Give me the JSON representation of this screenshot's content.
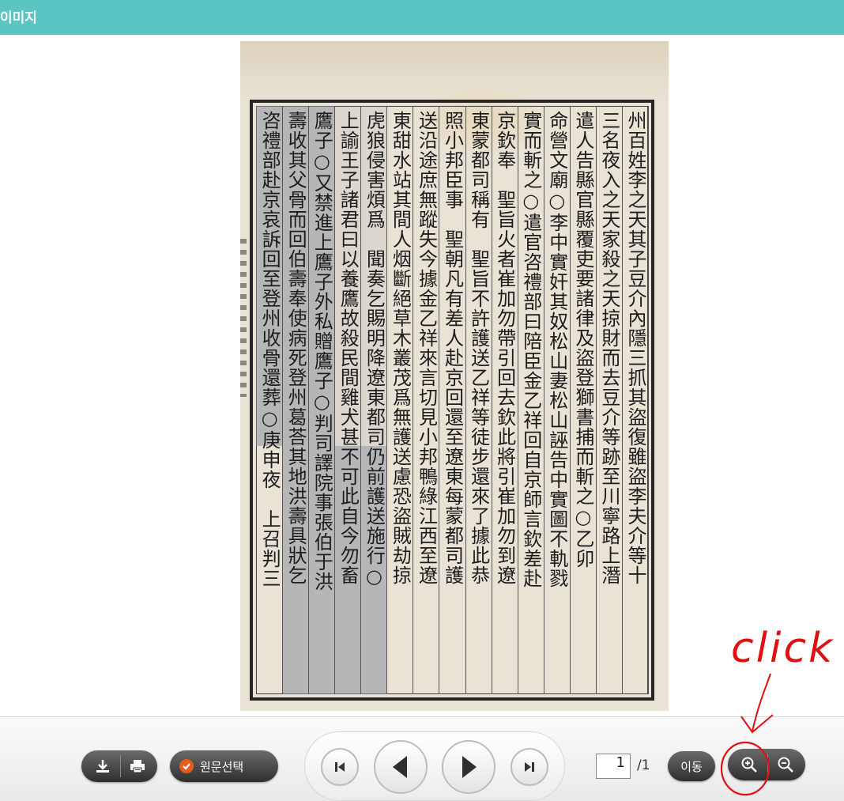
{
  "header": {
    "title": "이미지"
  },
  "document_image": {
    "columns": [
      "州百姓李之天其子豆介內隱三抓其盜復雖盜李夫介等十",
      "三名夜入之天家殺之天掠財而去豆介等跡至川寧路上潛",
      "遣人告縣官縣覆吏要諸律及盜登獅書捕而斬之○乙卯",
      "命營文廟○李中實奸其奴松山妻松山誣告中實圖不軌戮",
      "實而斬之○遣官咨禮部曰陪臣金乙祥回自京師言欽差赴",
      "京欽奉　聖旨火者崔加勿帶引回去欽此將引崔加勿到遼",
      "東蒙都司稱有　聖旨不許護送乙祥等徒步還來了據此恭",
      "照小邦臣事　聖朝凡有差人赴京回還至遼東每蒙都司護",
      "送沿途庶無蹤失今據金乙祥來言切見小邦鴨綠江西至遼",
      "東甜水站其間人烟斷絕草木叢茂爲無護送慮恐盜賊劫掠",
      "虎狼侵害煩爲　聞奏乞賜明降遼東都司仍前護送施行○",
      "上諭王子諸君曰以養鷹故殺民間雞犬甚不可此自今勿畜",
      "鷹子○又禁進上鷹子外私贈鷹子○判司譯院事張伯于洪",
      "壽收其父骨而回伯壽奉使病死登州葛荅其地洪壽具狀乞",
      "咨禮部赴京哀訴回至登州收骨還葬○庚申夜　上召判三"
    ]
  },
  "toolbar": {
    "download_label": "download",
    "print_label": "print",
    "original_select_label": "원문선택",
    "first_page_label": "first",
    "prev_page_label": "previous",
    "next_page_label": "next",
    "last_page_label": "last",
    "page_current": "1",
    "page_total": "/1",
    "goto_label": "이동",
    "zoom_in_label": "zoom in",
    "zoom_out_label": "zoom out"
  },
  "annotation": {
    "text": "click",
    "color": "#e01010"
  },
  "colors": {
    "header_bg": "#5bc5c4",
    "button_dark": "#3a3a3a",
    "check_orange": "#e85a1a"
  }
}
